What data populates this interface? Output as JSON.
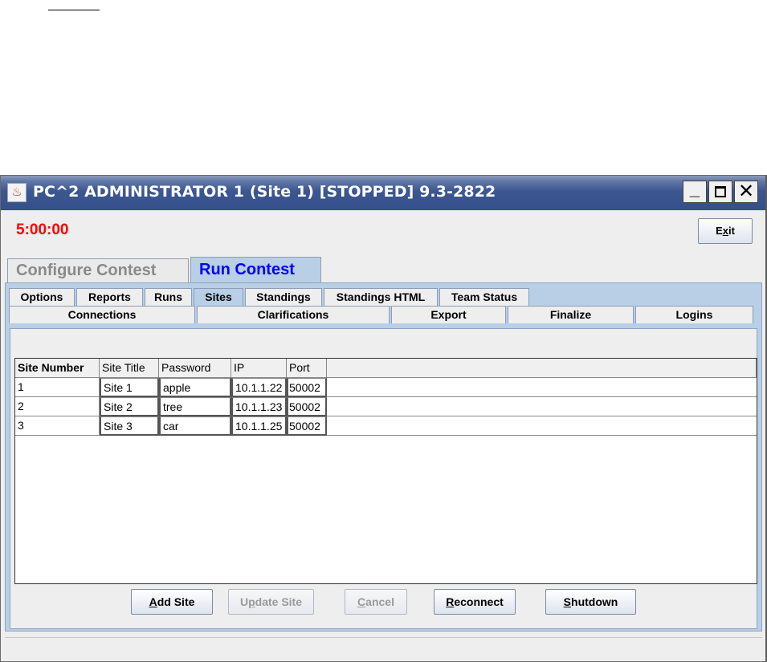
{
  "window": {
    "title": "PC^2 ADMINISTRATOR 1 (Site 1) [STOPPED] 9.3-2822",
    "minimize_glyph": "_",
    "close_glyph": "✕"
  },
  "timer": "5:00:00",
  "exit_button": {
    "pre": "E",
    "mnemonic": "x",
    "post": "it"
  },
  "main_tabs": [
    "Configure Contest",
    "Run Contest"
  ],
  "sub_tabs_row1": [
    "Options",
    "Reports",
    "Runs",
    "Sites",
    "Standings",
    "Standings HTML",
    "Team Status"
  ],
  "sub_tabs_row2": [
    "Connections",
    "Clarifications",
    "Export",
    "Finalize",
    "Logins"
  ],
  "selected_sub_tab": "Sites",
  "sites_table": {
    "columns": [
      "Site Number",
      "Site Title",
      "Password",
      "IP",
      "Port"
    ],
    "rows": [
      [
        "1",
        "Site 1",
        "apple",
        "10.1.1.22",
        "50002"
      ],
      [
        "2",
        "Site 2",
        "tree",
        "10.1.1.23",
        "50002"
      ],
      [
        "3",
        "Site 3",
        "car",
        "10.1.1.25",
        "50002"
      ]
    ]
  },
  "buttons": {
    "add_site": {
      "mnemonic": "A",
      "rest": "dd Site"
    },
    "update_site": {
      "pre": "U",
      "mnemonic": "p",
      "rest": "date Site"
    },
    "cancel": {
      "mnemonic": "C",
      "rest": "ancel"
    },
    "reconnect": {
      "mnemonic": "R",
      "rest": "econnect"
    },
    "shutdown": {
      "mnemonic": "S",
      "rest": "hutdown"
    }
  },
  "colors": {
    "timer": "#ff0000",
    "active_tab_text": "#0000ff",
    "inactive_tab_text": "#8a8a8a",
    "tab_panel": "#b8cfe5",
    "titlebar": "#3c5690"
  },
  "icons": {
    "app": "java-coffee-cup-icon"
  }
}
